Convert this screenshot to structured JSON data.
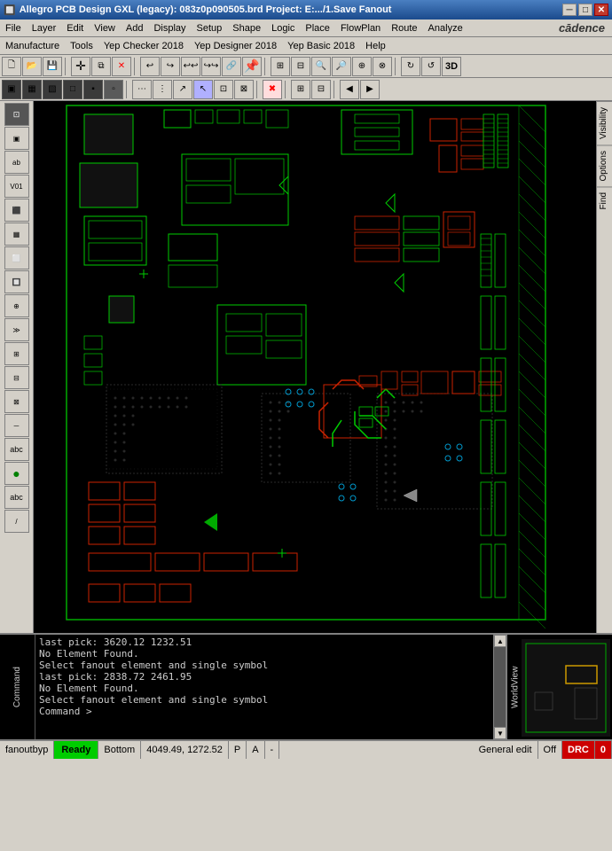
{
  "titlebar": {
    "icon": "🔲",
    "title": "Allegro PCB Design GXL (legacy): 083z0p090505.brd   Project: E:.../1.Save Fanout",
    "minimize": "─",
    "maximize": "□",
    "close": "✕"
  },
  "menubar1": {
    "items": [
      "File",
      "Layer",
      "Edit",
      "View",
      "Add",
      "Display",
      "Setup",
      "Shape",
      "Logic",
      "Place",
      "FlowPlan",
      "Route",
      "Analyze"
    ]
  },
  "menubar2": {
    "items": [
      "Manufacture",
      "Tools",
      "Yep Checker 2018",
      "Yep Designer 2018",
      "Yep Basic 2018",
      "Help"
    ]
  },
  "right_tabs": {
    "items": [
      "Visibility",
      "Options",
      "Find"
    ]
  },
  "command_lines": [
    "last pick:  3620.12 1232.51",
    "No Element Found.",
    "Select fanout element and single symbol",
    "last pick:  2838.72 2461.95",
    "No Element Found.",
    "Select fanout element and single symbol",
    "Command >"
  ],
  "statusbar": {
    "fanout": "fanoutbyp",
    "ready": "Ready",
    "layer": "Bottom",
    "coordinates": "4049.49, 1272.52",
    "p_indicator": "P",
    "a_indicator": "A",
    "dash": "-",
    "mode": "General edit",
    "off": "Off",
    "drc": "DRC",
    "drc_count": "0"
  },
  "cadence": {
    "logo": "cādence"
  }
}
